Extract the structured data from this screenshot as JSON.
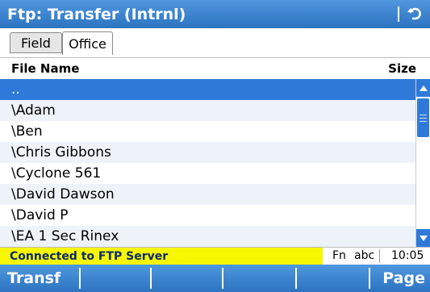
{
  "title": "Ftp: Transfer (Intrnl)",
  "tabs": [
    {
      "label": "Field",
      "active": false
    },
    {
      "label": "Office",
      "active": true
    }
  ],
  "columns": {
    "name": "File Name",
    "size": "Size"
  },
  "rows": [
    {
      "name": "..",
      "selected": true
    },
    {
      "name": "\\Adam"
    },
    {
      "name": "\\Ben"
    },
    {
      "name": "\\Chris Gibbons"
    },
    {
      "name": "\\Cyclone 561"
    },
    {
      "name": "\\David Dawson"
    },
    {
      "name": "\\David P"
    },
    {
      "name": "\\EA 1 Sec Rinex"
    }
  ],
  "status": {
    "message": "Connected to FTP Server",
    "fn": "Fn",
    "input_mode": "abc",
    "time": "10:05"
  },
  "softkeys": {
    "k1": "Transf",
    "k6": "Page"
  },
  "icons": {
    "back": "return-arrow-icon"
  },
  "colors": {
    "bar_blue": "#2d73c2",
    "selection": "#2f7ad9",
    "status_yellow": "#f7f700",
    "status_text": "#0b2a72"
  }
}
